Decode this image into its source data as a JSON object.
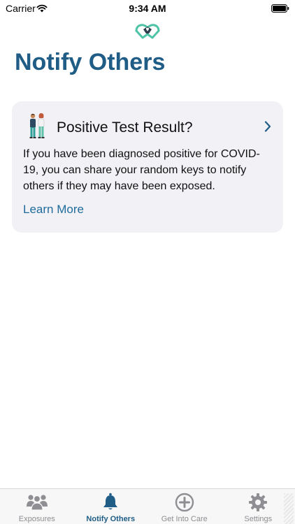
{
  "status_bar": {
    "carrier": "Carrier",
    "time": "9:34 AM"
  },
  "header": {
    "logo_icon": "hands-heart-icon",
    "title": "Notify Others"
  },
  "card": {
    "illustration_icon": "two-people-icon",
    "title": "Positive Test Result?",
    "body": "If you have been diagnosed positive for COVID-19, you can share your random keys to notify others if they may have been exposed.",
    "link": "Learn More"
  },
  "tab_bar": {
    "tabs": [
      {
        "label": "Exposures",
        "icon": "people-icon",
        "active": false
      },
      {
        "label": "Notify Others",
        "icon": "bell-icon",
        "active": true
      },
      {
        "label": "Get Into Care",
        "icon": "plus-circle-icon",
        "active": false
      },
      {
        "label": "Settings",
        "icon": "gear-icon",
        "active": false
      }
    ]
  },
  "colors": {
    "accent": "#1f5c86",
    "link": "#1f6c9c",
    "card_background": "#f1f1f6",
    "inactive_tab": "#8e8e93",
    "logo_teal": "#4fc3a6"
  }
}
